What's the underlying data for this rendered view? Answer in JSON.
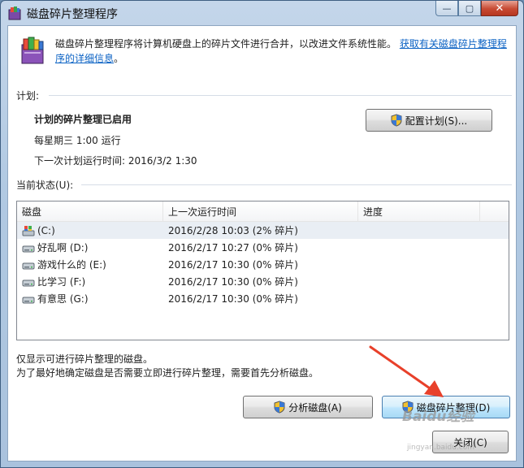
{
  "window": {
    "title": "磁盘碎片整理程序",
    "caption": {
      "minimize": "—",
      "maximize": "▢",
      "close": "✕"
    }
  },
  "header": {
    "description": "磁盘碎片整理程序将计算机硬盘上的碎片文件进行合并，以改进文件系统性能。",
    "link": "获取有关磁盘碎片整理程序的详细信息",
    "link_suffix": "。"
  },
  "schedule": {
    "section_label": "计划:",
    "status": "计划的碎片整理已启用",
    "frequency": "每星期三  1:00 运行",
    "next_run": "下一次计划运行时间: 2016/3/2 1:30",
    "configure_button": "配置计划(S)..."
  },
  "current_status": {
    "section_label": "当前状态(U):",
    "columns": [
      "磁盘",
      "上一次运行时间",
      "进度"
    ],
    "rows": [
      {
        "disk": "(C:)",
        "last_run": "2016/2/28 10:03 (2% 碎片)",
        "progress": "",
        "icon": "system-drive-icon"
      },
      {
        "disk": "好乱啊 (D:)",
        "last_run": "2016/2/17 10:27 (0% 碎片)",
        "progress": "",
        "icon": "drive-icon"
      },
      {
        "disk": "游戏什么的 (E:)",
        "last_run": "2016/2/17 10:30 (0% 碎片)",
        "progress": "",
        "icon": "drive-icon"
      },
      {
        "disk": "比学习 (F:)",
        "last_run": "2016/2/17 10:30 (0% 碎片)",
        "progress": "",
        "icon": "drive-icon"
      },
      {
        "disk": "有意思 (G:)",
        "last_run": "2016/2/17 10:30 (0% 碎片)",
        "progress": "",
        "icon": "drive-icon"
      }
    ]
  },
  "notes": {
    "line1": "仅显示可进行碎片整理的磁盘。",
    "line2": "为了最好地确定磁盘是否需要立即进行碎片整理，需要首先分析磁盘。"
  },
  "actions": {
    "analyze_button": "分析磁盘(A)",
    "defrag_button": "磁盘碎片整理(D)",
    "close_button": "关闭(C)"
  },
  "watermark": {
    "brand": "Baidu经验",
    "url": "jingyan.baidu.com"
  },
  "colors": {
    "link": "#0b62c4",
    "annotation_arrow": "#e8402a",
    "title_bar": "#b1c9e2"
  }
}
